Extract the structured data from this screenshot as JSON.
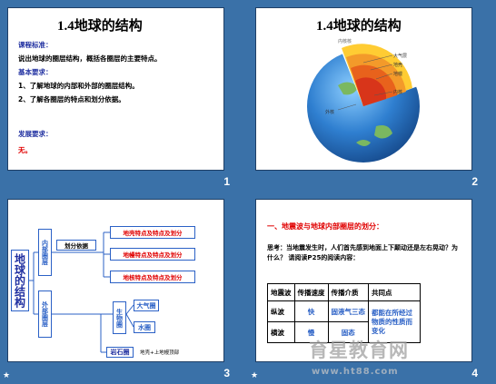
{
  "slides": [
    {
      "num": "1",
      "title": "1.4地球的结构",
      "lines": {
        "h1": "课程标准：",
        "p1": "说出地球的圈层结构，概括各圈层的主要特点。",
        "h2": "基本要求：",
        "p2": "1、了解地球的内部和外部的圈层结构。",
        "p3": "2、了解各圈层的特点和划分依据。",
        "h3": "发展要求：",
        "p4": "无。"
      }
    },
    {
      "num": "2",
      "title": "1.4地球的结构",
      "labels": {
        "l1": "大气层",
        "l2": "地壳",
        "l3": "地幔",
        "l4": "内核",
        "l5": "外核",
        "l6": "内核核"
      }
    },
    {
      "num": "3",
      "main": "地球的结构",
      "inner": "内部圈层",
      "outer": "外部圈层",
      "basis": "划分依据",
      "layers": [
        "地壳特点及特点及划分",
        "地幔特点及特点及划分",
        "地核特点及特点及划分"
      ],
      "outer_items": {
        "water": "水圈",
        "air": "大气圈",
        "bio": "生物圈"
      },
      "rock": "岩石圈",
      "rock_note": "地壳+上地幔顶部"
    },
    {
      "num": "4",
      "heading": "一、地震波与地球内部圈层的划分：",
      "question": "思考：当地震发生时，人们首先感到地面上下颠动还是左右晃动？为什么？ 请阅读P25的阅读内容：",
      "table": {
        "header": [
          "地震波",
          "传播速度",
          "传播介质",
          "共同点"
        ],
        "rows": [
          [
            "纵波",
            "快",
            "固液气三态",
            "都能在所经过物质的性质而变化"
          ],
          [
            "横波",
            "慢",
            "固态",
            ""
          ]
        ]
      },
      "watermark_big": "育星教育网",
      "watermark_small": "www.ht88.com"
    }
  ],
  "colors": {
    "background": "#3a71a8",
    "accent_blue": "#2b61c6",
    "accent_red": "#e00000"
  }
}
